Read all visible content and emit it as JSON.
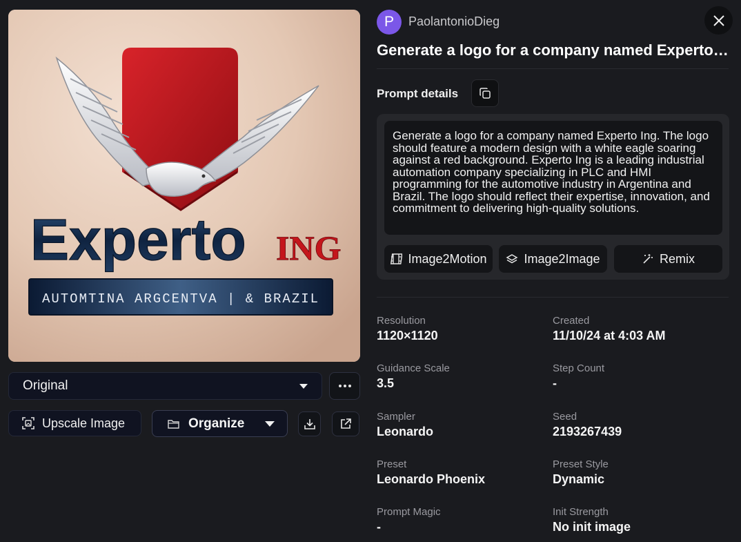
{
  "image": {
    "logo_word_main": "Experto",
    "logo_word_accent": "ING",
    "logo_tagline": "AUTOMTINA ARGCENTVA  | & BRAZIL"
  },
  "left_controls": {
    "version_label": "Original",
    "upscale_label": "Upscale Image",
    "organize_label": "Organize"
  },
  "author": {
    "initial": "P",
    "name": "PaolantonioDieg"
  },
  "title": "Generate a logo for a company named Experto Ing. The logo should feature a modern design with a white eagle soaring against a red background.",
  "prompt": {
    "label": "Prompt details",
    "text": "Generate a logo for a company named Experto Ing. The logo should feature a modern design with a white eagle soaring against a red background. Experto Ing is a leading industrial automation company specializing in PLC and HMI programming for the automotive industry in Argentina and Brazil. The logo should reflect their expertise, innovation, and commitment to delivering high-quality solutions.",
    "actions": [
      "Image2Motion",
      "Image2Image",
      "Remix"
    ]
  },
  "details": [
    {
      "label": "Resolution",
      "value": "1120×1120"
    },
    {
      "label": "Created",
      "value": "11/10/24 at 4:03 AM"
    },
    {
      "label": "Guidance Scale",
      "value": "3.5"
    },
    {
      "label": "Step Count",
      "value": "-"
    },
    {
      "label": "Sampler",
      "value": "Leonardo"
    },
    {
      "label": "Seed",
      "value": "2193267439"
    },
    {
      "label": "Preset",
      "value": "Leonardo Phoenix"
    },
    {
      "label": "Preset Style",
      "value": "Dynamic"
    },
    {
      "label": "Prompt Magic",
      "value": "-"
    },
    {
      "label": "Init Strength",
      "value": "No init image"
    }
  ],
  "colors": {
    "background": "#1a1b1f",
    "avatar": "#7b57e8",
    "logo_red": "#c4161c"
  },
  "icons": [
    "close-icon",
    "copy-icon",
    "more-icon",
    "upscale-icon",
    "folder-icon",
    "download-icon",
    "share-icon",
    "film-icon",
    "layers-icon",
    "magic-wand-icon"
  ]
}
